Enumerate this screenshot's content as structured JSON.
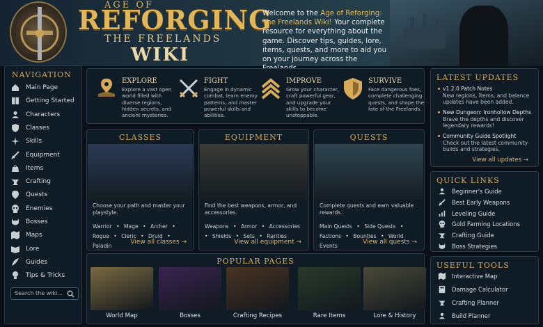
{
  "hero": {
    "logo_top": "AGE OF",
    "logo_main": "REFORGING",
    "logo_sub": "THE FREELANDS",
    "logo_wiki": "WIKI",
    "welcome_pre": "Welcome to the ",
    "welcome_accent": "Age of Reforging: The Freelands Wiki!",
    "welcome_post": " Your complete resource for everything about the game. Discover tips, guides, lore, items, quests, and more to aid you on your journey across the Freelands."
  },
  "nav": {
    "title": "NAVIGATION",
    "items": [
      {
        "label": "Main Page",
        "icon": "home-icon"
      },
      {
        "label": "Getting Started",
        "icon": "book-icon"
      },
      {
        "label": "Characters",
        "icon": "user-icon"
      },
      {
        "label": "Classes",
        "icon": "shield-icon"
      },
      {
        "label": "Skills",
        "icon": "burst-icon"
      },
      {
        "label": "Equipment",
        "icon": "sword-icon"
      },
      {
        "label": "Items",
        "icon": "bag-icon"
      },
      {
        "label": "Crafting",
        "icon": "anvil-icon"
      },
      {
        "label": "Quests",
        "icon": "marker-icon"
      },
      {
        "label": "Enemies",
        "icon": "skull-icon"
      },
      {
        "label": "Bosses",
        "icon": "demon-icon"
      },
      {
        "label": "Maps",
        "icon": "map-icon"
      },
      {
        "label": "Lore",
        "icon": "open-book-icon"
      },
      {
        "label": "Guides",
        "icon": "quill-icon"
      },
      {
        "label": "Tips & Tricks",
        "icon": "lightbulb-icon"
      }
    ],
    "search_placeholder": "Search the wiki..."
  },
  "features": [
    {
      "title": "EXPLORE",
      "desc": "Explore a vast open world filled with diverse regions, hidden secrets, and ancient mysteries.",
      "icon": "map-pin-icon"
    },
    {
      "title": "FIGHT",
      "desc": "Engage in dynamic combat, learn enemy patterns, and master powerful skills and abilities.",
      "icon": "crossed-swords-icon"
    },
    {
      "title": "IMPROVE",
      "desc": "Grow your character, craft powerful gear, and upgrade your skills to become unstoppable.",
      "icon": "chevrons-up-icon"
    },
    {
      "title": "SURVIVE",
      "desc": "Face dangerous foes, complete challenging quests, and shape the fate of the Freelands.",
      "icon": "shield-icon"
    }
  ],
  "cards": [
    {
      "title": "CLASSES",
      "desc": "Choose your path and master your playstyle.",
      "links": [
        "Warrior",
        "Mage",
        "Archer",
        "Rogue",
        "Cleric",
        "Druid",
        "Paladin"
      ],
      "more": "View all classes →",
      "color": "#2b3a55"
    },
    {
      "title": "EQUIPMENT",
      "desc": "Find the best weapons, armor, and accessories.",
      "links": [
        "Weapons",
        "Armor",
        "Accessories",
        "Shields",
        "Sets",
        "Rarities"
      ],
      "more": "View all equipment →",
      "color": "#3b3a36"
    },
    {
      "title": "QUESTS",
      "desc": "Complete quests and earn valuable rewards.",
      "links": [
        "Main Quests",
        "Side Quests",
        "Factions",
        "Bounties",
        "World Events"
      ],
      "more": "View all quests →",
      "color": "#2f4550"
    }
  ],
  "popular": {
    "title": "POPULAR PAGES",
    "items": [
      {
        "label": "World Map",
        "color": "#7a6a42"
      },
      {
        "label": "Bosses",
        "color": "#3a2450"
      },
      {
        "label": "Crafting Recipes",
        "color": "#4a3424"
      },
      {
        "label": "Rare Items",
        "color": "#2a3a2a"
      },
      {
        "label": "Lore & History",
        "color": "#4a4a3a"
      }
    ]
  },
  "updates": {
    "title": "LATEST UPDATES",
    "items": [
      {
        "title": "v1.2.0 Patch Notes",
        "desc": "New regions, items, and balance updates have been added."
      },
      {
        "title": "New Dungeon: Ironhollow Depths",
        "desc": "Brave the depths and discover legendary rewards!"
      },
      {
        "title": "Community Guide Spotlight",
        "desc": "Check out the latest community builds and strategies."
      }
    ],
    "more": "View all updates →"
  },
  "quick_links": {
    "title": "QUICK LINKS",
    "items": [
      {
        "label": "Beginner's Guide",
        "icon": "user-icon"
      },
      {
        "label": "Best Early Weapons",
        "icon": "sword-icon"
      },
      {
        "label": "Leveling Guide",
        "icon": "chart-icon"
      },
      {
        "label": "Gold Farming Locations",
        "icon": "skull-icon"
      },
      {
        "label": "Crafting Guide",
        "icon": "anvil-icon"
      },
      {
        "label": "Boss Strategies",
        "icon": "demon-icon"
      }
    ]
  },
  "tools": {
    "title": "USEFUL TOOLS",
    "items": [
      {
        "label": "Interactive Map",
        "icon": "map-icon"
      },
      {
        "label": "Damage Calculator",
        "icon": "calculator-icon"
      },
      {
        "label": "Crafting Planner",
        "icon": "anvil-icon"
      },
      {
        "label": "Build Planner",
        "icon": "user-icon"
      }
    ]
  }
}
